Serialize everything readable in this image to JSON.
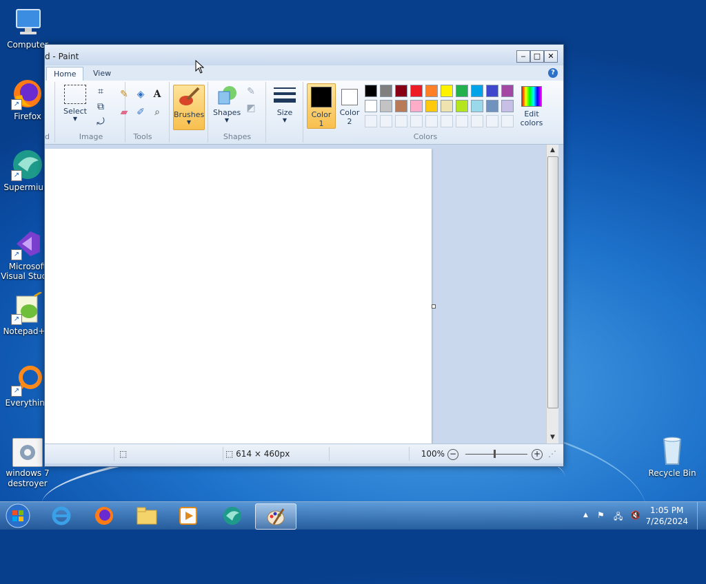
{
  "desktop": {
    "icons": [
      {
        "label": "Computer"
      },
      {
        "label": "Firefox"
      },
      {
        "label": "Supermium"
      },
      {
        "label": "Microsoft Visual Studio"
      },
      {
        "label": "Notepad++"
      },
      {
        "label": "Everything"
      },
      {
        "label": "windows 7 destroyer"
      },
      {
        "label": "Recycle Bin"
      }
    ]
  },
  "window": {
    "title": "d - Paint",
    "min": "‒",
    "max": "□",
    "close": "✕"
  },
  "tabs": {
    "home": "Home",
    "view": "View",
    "help": "?"
  },
  "ribbon": {
    "clipboard_label": "d",
    "image": {
      "select": "Select",
      "label": "Image"
    },
    "tools": {
      "label": "Tools",
      "text": "A"
    },
    "brushes": {
      "label": "Brushes"
    },
    "shapes": {
      "button": "Shapes",
      "label": "Shapes"
    },
    "size": {
      "label": "Size"
    },
    "color1": {
      "line1": "Color",
      "line2": "1",
      "value": "#000000"
    },
    "color2": {
      "line1": "Color",
      "line2": "2",
      "value": "#ffffff"
    },
    "colors_label": "Colors",
    "edit_colors": {
      "line1": "Edit",
      "line2": "colors"
    },
    "palette_row1": [
      "#000000",
      "#7f7f7f",
      "#880015",
      "#ed1c24",
      "#ff7f27",
      "#fff200",
      "#22b14c",
      "#00a2e8",
      "#3f48cc",
      "#a349a4"
    ],
    "palette_row2": [
      "#ffffff",
      "#c3c3c3",
      "#b97a57",
      "#ffaec9",
      "#ffc90e",
      "#efe4b0",
      "#b5e61d",
      "#99d9ea",
      "#7092be",
      "#c8bfe7"
    ]
  },
  "status": {
    "canvas_size": "614 × 460px",
    "zoom": "100%",
    "zoom_out": "−",
    "zoom_in": "+"
  },
  "taskbar": {
    "time": "1:05 PM",
    "date": "7/26/2024",
    "tray_up": "▲"
  }
}
